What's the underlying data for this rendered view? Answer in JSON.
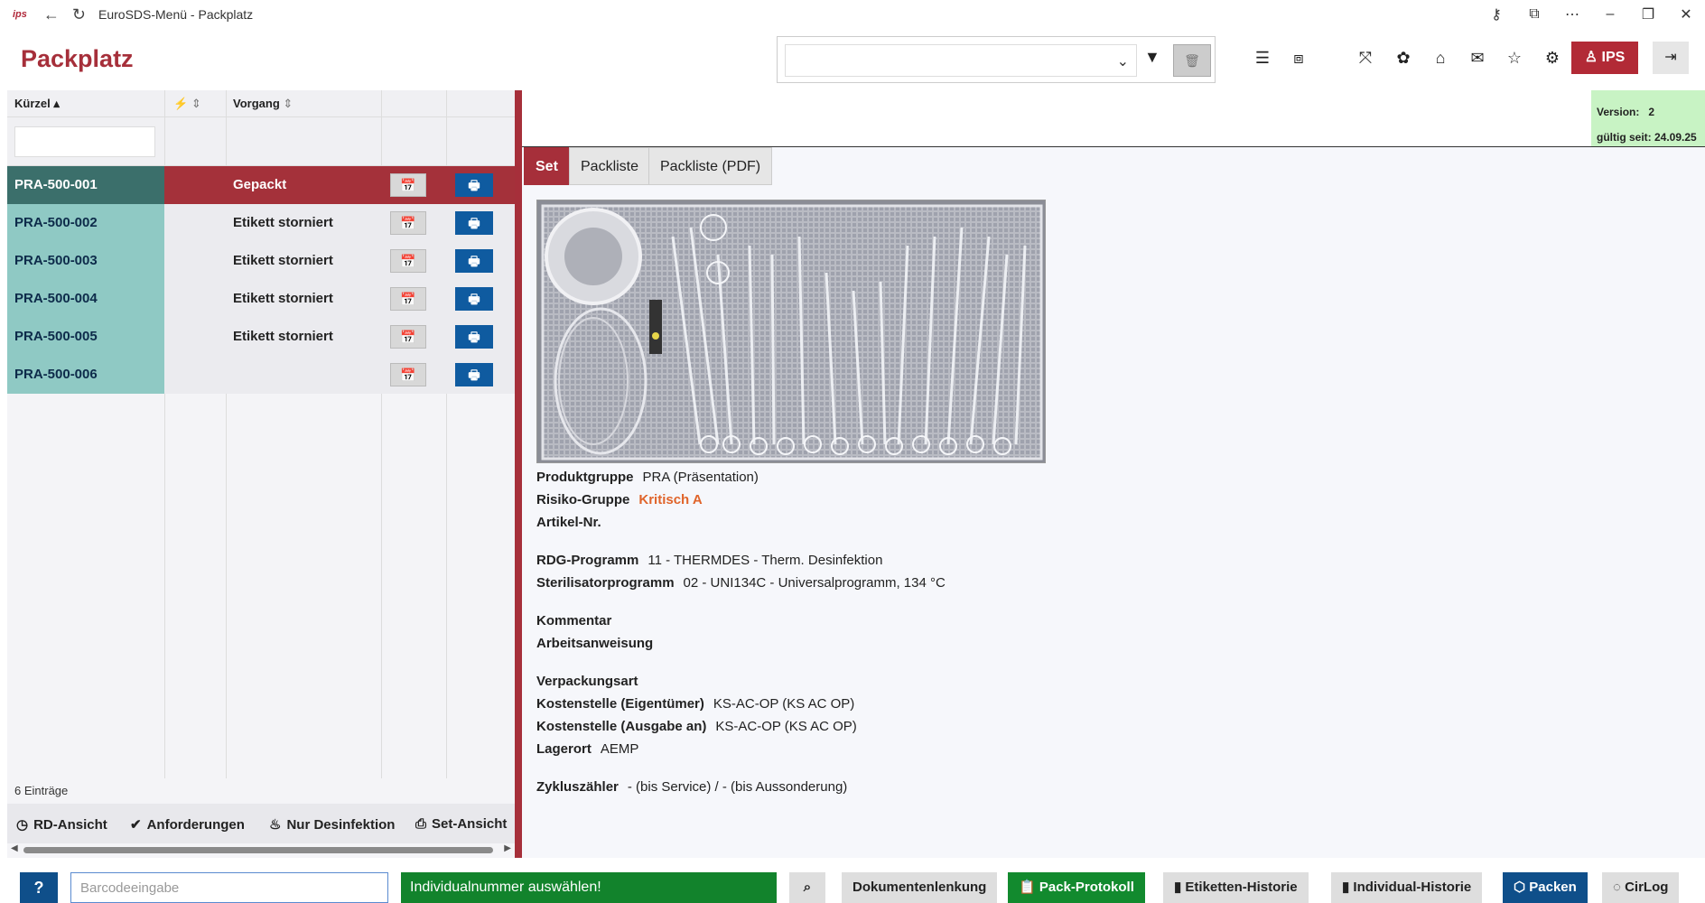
{
  "window": {
    "logo": "ips",
    "title": "EuroSDS-Menü - Packplatz"
  },
  "header": {
    "page_title": "Packplatz",
    "user_label": "IPS"
  },
  "grid": {
    "columns": [
      "Kürzel",
      "Vorgang"
    ],
    "rows": [
      {
        "kurzel": "PRA-500-001",
        "vorgang": "Gepackt"
      },
      {
        "kurzel": "PRA-500-002",
        "vorgang": "Etikett storniert"
      },
      {
        "kurzel": "PRA-500-003",
        "vorgang": "Etikett storniert"
      },
      {
        "kurzel": "PRA-500-004",
        "vorgang": "Etikett storniert"
      },
      {
        "kurzel": "PRA-500-005",
        "vorgang": "Etikett storniert"
      },
      {
        "kurzel": "PRA-500-006",
        "vorgang": ""
      }
    ],
    "entries": "6 Einträge"
  },
  "view_bar": {
    "rd": "RD-Ansicht",
    "anforderungen": "Anforderungen",
    "desinfektion": "Nur Desinfektion",
    "set": "Set-Ansicht"
  },
  "version": {
    "label": "Version:",
    "value": "2",
    "valid_label": "gültig seit: 24.09.25"
  },
  "tabs": [
    "Set",
    "Packliste",
    "Packliste (PDF)"
  ],
  "details": {
    "produktgruppe_label": "Produktgruppe",
    "produktgruppe": "PRA (Präsentation)",
    "risiko_label": "Risiko-Gruppe",
    "risiko": "Kritisch A",
    "artikel_label": "Artikel-Nr.",
    "rdg_label": "RDG-Programm",
    "rdg": "11 - THERMDES - Therm. Desinfektion",
    "steri_label": "Sterilisatorprogramm",
    "steri": "02 - UNI134C - Universalprogramm, 134 °C",
    "kommentar_label": "Kommentar",
    "arbeitsanweisung_label": "Arbeitsanweisung",
    "verpackung_label": "Verpackungsart",
    "kst_eigen_label": "Kostenstelle (Eigentümer)",
    "kst_eigen": "KS-AC-OP (KS AC OP)",
    "kst_ausgabe_label": "Kostenstelle (Ausgabe an)",
    "kst_ausgabe": "KS-AC-OP (KS AC OP)",
    "lagerort_label": "Lagerort",
    "lagerort": "AEMP",
    "zyklus_label": "Zykluszähler",
    "zyklus": "- (bis Service) / - (bis Aussonderung)"
  },
  "bottom": {
    "help": "?",
    "barcode_placeholder": "Barcodeeingabe",
    "status": "Individualnummer auswählen!",
    "dokument": "Dokumentenlenkung",
    "pack_protokoll": "Pack-Protokoll",
    "etiketten": "Etiketten-Historie",
    "individual": "Individual-Historie",
    "packen": "Packen",
    "cirlog": "CirLog"
  },
  "colors": {
    "brand": "#a62f3a",
    "teal": "#8fc9c4",
    "print_blue": "#0f5ba0",
    "status_green": "#12832c",
    "critical": "#e0642a"
  }
}
